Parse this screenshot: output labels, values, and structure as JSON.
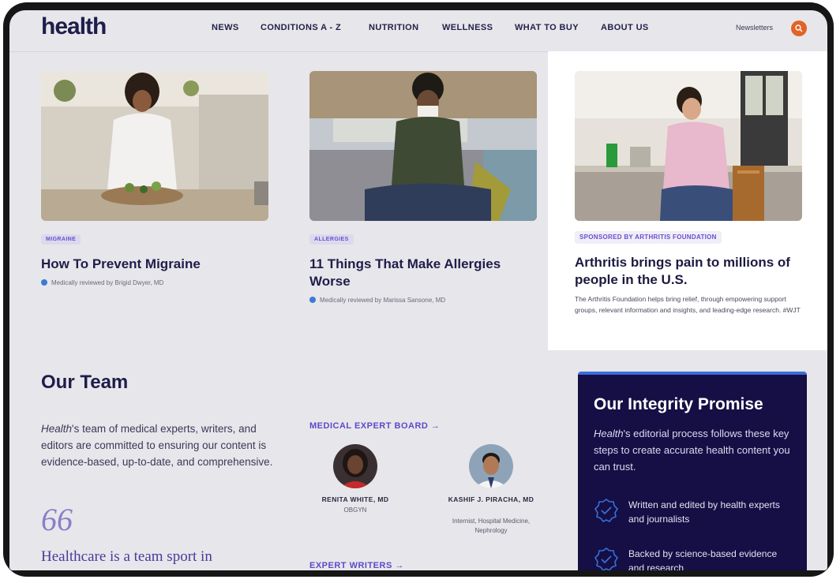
{
  "header": {
    "logo": "health",
    "nav": [
      "NEWS",
      "CONDITIONS A - Z",
      "NUTRITION",
      "WELLNESS",
      "WHAT TO BUY",
      "ABOUT US"
    ],
    "newsletters": "Newsletters",
    "search_icon": "search-icon"
  },
  "cards": [
    {
      "tag": "MIGRAINE",
      "title": "How To Prevent Migraine",
      "reviewed": "Medically reviewed by Brigid Dwyer, MD"
    },
    {
      "tag": "ALLERGIES",
      "title": "11 Things That Make Allergies Worse",
      "reviewed": "Medically reviewed by Marissa Sansone, MD"
    }
  ],
  "sponsored": {
    "tag": "SPONSORED BY ARTHRITIS FOUNDATION",
    "title": "Arthritis brings pain to millions of people in the U.S.",
    "text": "The Arthritis Foundation helps bring relief, through empowering support groups, relevant information and insights, and leading-edge research. #WJT"
  },
  "team": {
    "heading": "Our Team",
    "text_em": "Health",
    "text": "'s team of medical experts, writers, and editors are committed to ensuring our content is evidence-based, up-to-date, and comprehensive.",
    "quote_mark": "66",
    "quote": "Healthcare is a team sport in"
  },
  "experts": {
    "board_link": "MEDICAL EXPERT BOARD →",
    "people": [
      {
        "name": "RENITA WHITE, MD",
        "role": "OBGYN"
      },
      {
        "name": "KASHIF J. PIRACHA, MD",
        "role": "Internist, Hospital Medicine, Nephrology"
      }
    ],
    "writers_link": "EXPERT WRITERS →"
  },
  "promise": {
    "title": "Our Integrity Promise",
    "text_em": "Health",
    "text": "'s editorial process follows these key steps to create accurate health content you can trust.",
    "items": [
      "Written and edited by health experts and journalists",
      "Backed by science-based evidence and research"
    ]
  },
  "colors": {
    "accent": "#5a4bc9",
    "brand": "#1f1d4a",
    "promise_bg": "#150f45",
    "search_bg": "#e26326"
  }
}
